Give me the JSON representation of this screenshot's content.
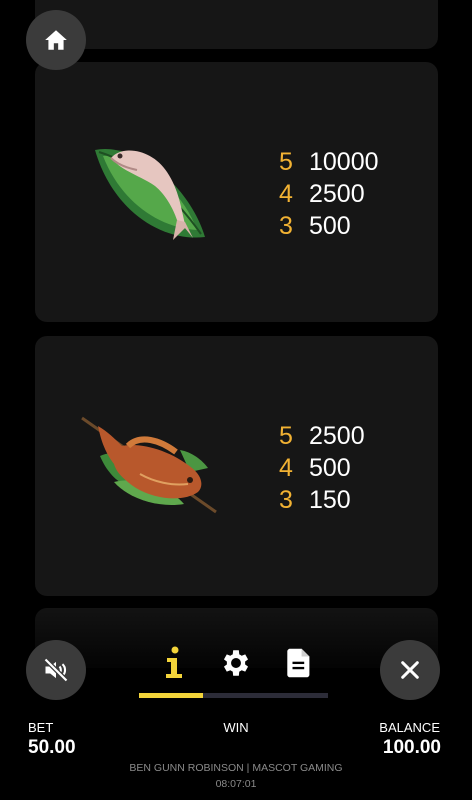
{
  "paytable": [
    {
      "symbol_icon": "fish-on-leaf-icon",
      "rows": [
        {
          "count": "5",
          "amount": "10000"
        },
        {
          "count": "4",
          "amount": "2500"
        },
        {
          "count": "3",
          "amount": "500"
        }
      ]
    },
    {
      "symbol_icon": "skewered-fish-icon",
      "rows": [
        {
          "count": "5",
          "amount": "2500"
        },
        {
          "count": "4",
          "amount": "500"
        },
        {
          "count": "3",
          "amount": "150"
        }
      ]
    }
  ],
  "nav": {
    "home_icon": "home-icon",
    "sound_icon": "sound-muted-icon",
    "close_icon": "close-icon",
    "tabs": [
      {
        "icon": "info-icon",
        "active": true
      },
      {
        "icon": "gear-icon",
        "active": false
      },
      {
        "icon": "document-icon",
        "active": false
      }
    ],
    "tab_progress": 0.34
  },
  "colors": {
    "accent": "#f3d43a",
    "multiplier": "#f2b233",
    "card": "#161616",
    "button": "#3b3b3b"
  },
  "bottom_bar": {
    "bet_label": "BET",
    "bet_value": "50.00",
    "win_label": "WIN",
    "balance_label": "BALANCE",
    "balance_value": "100.00"
  },
  "footer": {
    "credit": "BEN GUNN ROBINSON | MASCOT GAMING",
    "time": "08:07:01"
  }
}
